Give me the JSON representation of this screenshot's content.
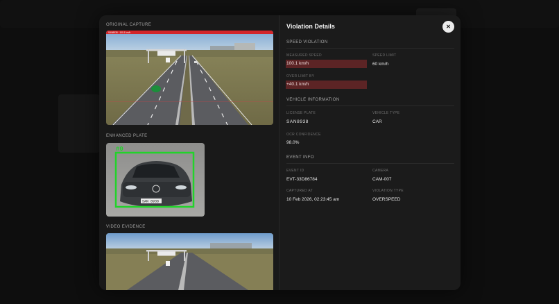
{
  "left": {
    "original_capture_label": "ORIGINAL CAPTURE",
    "enhanced_plate_label": "ENHANCED PLATE",
    "video_evidence_label": "VIDEO EVIDENCE",
    "capture_banner_text": "SAN8938 · 100.1 km/h"
  },
  "details": {
    "title": "Violation Details",
    "close_glyph": "✕",
    "speed_section": "SPEED VIOLATION",
    "measured_speed_label": "MEASURED SPEED",
    "measured_speed_value": "100.1 km/h",
    "speed_limit_label": "SPEED LIMIT",
    "speed_limit_value": "60 km/h",
    "over_limit_label": "OVER LIMIT BY",
    "over_limit_value": "+40.1 km/h",
    "vehicle_section": "VEHICLE INFORMATION",
    "license_plate_label": "LICENSE PLATE",
    "license_plate_value": "SAN8938",
    "vehicle_type_label": "VEHICLE TYPE",
    "vehicle_type_value": "CAR",
    "ocr_label": "OCR CONFIDENCE",
    "ocr_value": "98.0%",
    "event_section": "EVENT INFO",
    "event_id_label": "EVENT ID",
    "event_id_value": "EVT-33D86784",
    "camera_label": "CAMERA",
    "camera_value": "CAM-007",
    "captured_at_label": "CAPTURED AT",
    "captured_at_value": "10 Feb 2026, 02:23:45 am",
    "violation_type_label": "VIOLATION TYPE",
    "violation_type_value": "OVERSPEED"
  },
  "plate": {
    "detection_tag": "#0",
    "plate_text": "SAN 8938"
  },
  "colors": {
    "highlight": "#5c2425",
    "detection_box": "#22d32a",
    "banner_red": "#d2252a"
  },
  "icons": {
    "close": "close-icon"
  }
}
